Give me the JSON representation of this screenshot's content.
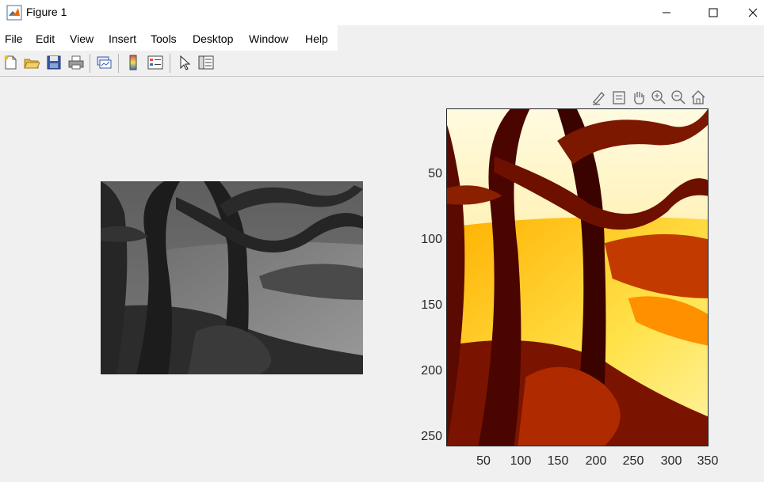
{
  "window": {
    "title": "Figure 1",
    "icon": "matlab-icon",
    "controls": [
      "minimize",
      "maximize",
      "close"
    ]
  },
  "menu": {
    "items": [
      "File",
      "Edit",
      "View",
      "Insert",
      "Tools",
      "Desktop",
      "Window",
      "Help"
    ]
  },
  "toolbar": {
    "buttons": [
      "new-figure-icon",
      "open-file-icon",
      "save-icon",
      "print-icon",
      "link-plot-icon",
      "insert-colorbar-icon",
      "insert-legend-icon",
      "edit-plot-icon",
      "property-inspector-icon"
    ]
  },
  "axes_toolbar": {
    "buttons": [
      "brush-icon",
      "data-tips-icon",
      "pan-icon",
      "zoom-in-icon",
      "zoom-out-icon",
      "restore-view-icon"
    ]
  },
  "left_image": {
    "description_colormap": "gray"
  },
  "right_image": {
    "colormap": "hot"
  },
  "chart_data": {
    "type": "heatmap",
    "title": "",
    "xlabel": "",
    "ylabel": "",
    "x_ticks": [
      "50",
      "100",
      "150",
      "200",
      "250",
      "300",
      "350"
    ],
    "y_ticks": [
      "50",
      "100",
      "150",
      "200",
      "250"
    ],
    "xlim": [
      0.5,
      350.5
    ],
    "ylim": [
      0.5,
      258.5
    ],
    "y_direction": "reverse",
    "grid": false,
    "colormap": "hot"
  }
}
